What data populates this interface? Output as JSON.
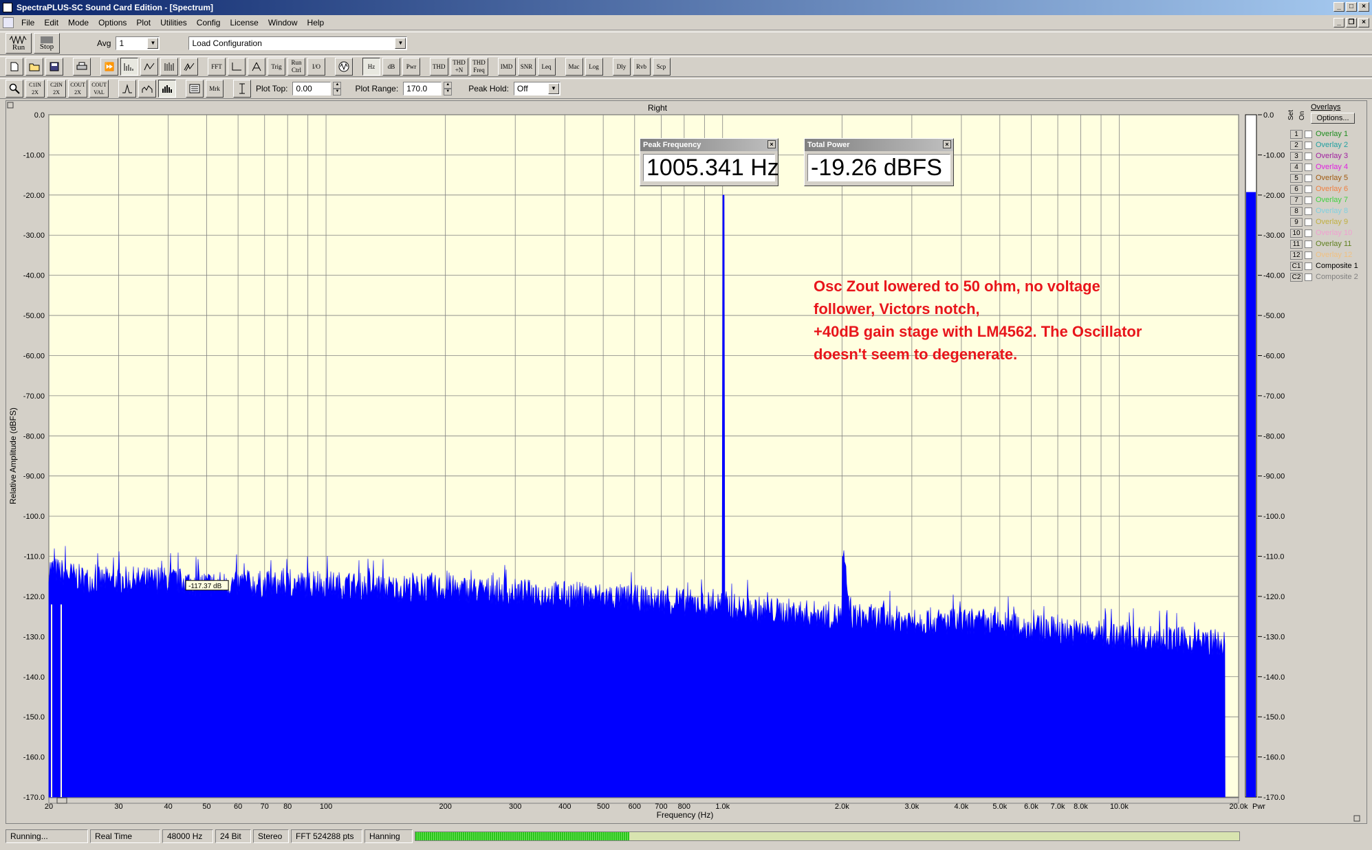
{
  "window": {
    "title": "SpectraPLUS-SC Sound Card Edition - [Spectrum]"
  },
  "menu": [
    "File",
    "Edit",
    "Mode",
    "Options",
    "Plot",
    "Utilities",
    "Config",
    "License",
    "Window",
    "Help"
  ],
  "toolbar1": {
    "run": "Run",
    "stop": "Stop",
    "avg_label": "Avg",
    "avg_value": "1",
    "config_value": "Load Configuration"
  },
  "toolbar2": {
    "buttons": [
      "FFT",
      "Trig",
      "Run Ctrl",
      "I/O",
      "Hz",
      "dB",
      "Pwr",
      "THD",
      "THD +N",
      "THD Freq",
      "IMD",
      "SNR",
      "Leq",
      "Mac",
      "Log",
      "Dly",
      "Rvb",
      "Scp"
    ]
  },
  "toolbar3": {
    "c1n": "C1IN 2X",
    "c2n": "C2IN 2X",
    "cout": "COUT 2X",
    "coutval": "COUT VAL",
    "mrk": "Mrk",
    "plot_top_label": "Plot Top:",
    "plot_top_value": "0.00",
    "plot_range_label": "Plot Range:",
    "plot_range_value": "170.0",
    "peak_hold_label": "Peak Hold:",
    "peak_hold_value": "Off"
  },
  "plot": {
    "channel_label": "Right",
    "marker_label": "-117.37 dB",
    "pwr_label": "Pwr",
    "annotation": [
      "Osc Zout lowered to 50 ohm, no voltage",
      "follower, Victors notch,",
      "+40dB gain stage with LM4562. The Oscillator",
      "doesn't seem to degenerate."
    ]
  },
  "peak_frequency": {
    "title": "Peak Frequency",
    "value": "1005.341 Hz"
  },
  "total_power": {
    "title": "Total Power",
    "value": "-19.26 dBFS"
  },
  "overlays": {
    "title": "Overlays",
    "options": "Options...",
    "set": "Set",
    "on": "On",
    "items": [
      {
        "num": "1",
        "label": "Overlay 1",
        "color": "#1e8c1e"
      },
      {
        "num": "2",
        "label": "Overlay 2",
        "color": "#20a0a0"
      },
      {
        "num": "3",
        "label": "Overlay 3",
        "color": "#a020a0"
      },
      {
        "num": "4",
        "label": "Overlay 4",
        "color": "#e020e0"
      },
      {
        "num": "5",
        "label": "Overlay 5",
        "color": "#a05a10"
      },
      {
        "num": "6",
        "label": "Overlay 6",
        "color": "#f08040"
      },
      {
        "num": "7",
        "label": "Overlay 7",
        "color": "#40d040"
      },
      {
        "num": "8",
        "label": "Overlay 8",
        "color": "#80d0e0"
      },
      {
        "num": "9",
        "label": "Overlay 9",
        "color": "#c0b040"
      },
      {
        "num": "10",
        "label": "Overlay 10",
        "color": "#f0a0d0"
      },
      {
        "num": "11",
        "label": "Overlay 11",
        "color": "#608020"
      },
      {
        "num": "12",
        "label": "Overlay 12",
        "color": "#f0c080"
      },
      {
        "num": "C1",
        "label": "Composite 1",
        "color": "#000000"
      },
      {
        "num": "C2",
        "label": "Composite 2",
        "color": "#808080"
      }
    ]
  },
  "status": {
    "state": "Running...",
    "mode": "Real Time",
    "rate": "48000 Hz",
    "bits": "24 Bit",
    "channels": "Stereo",
    "fft": "FFT 524288 pts",
    "window": "Hanning",
    "meter_level": 0.26
  },
  "colors": {
    "plot_bg": "#ffffe0",
    "spectrum": "#0000ff",
    "grid": "#808080",
    "annotation": "#e8151b"
  },
  "chart_data": {
    "type": "area",
    "xlabel": "Frequency (Hz)",
    "ylabel": "Relative Amplitude (dBFS)",
    "x_scale": "log",
    "xlim": [
      20,
      20000
    ],
    "ylim": [
      -170,
      0
    ],
    "x_ticks": [
      20,
      30,
      40,
      50,
      60,
      70,
      80,
      100,
      200,
      300,
      400,
      500,
      600,
      700,
      800,
      1000,
      2000,
      3000,
      4000,
      5000,
      6000,
      7000,
      8000,
      10000,
      20000
    ],
    "x_tick_labels": [
      "20",
      "30",
      "40",
      "50",
      "60",
      "70",
      "80",
      "100",
      "200",
      "300",
      "400",
      "500",
      "600",
      "700",
      "800",
      "1.0k",
      "2.0k",
      "3.0k",
      "4.0k",
      "5.0k",
      "6.0k",
      "7.0k",
      "8.0k",
      "10.0k",
      "20.0k"
    ],
    "y_ticks": [
      0,
      -10,
      -20,
      -30,
      -40,
      -50,
      -60,
      -70,
      -80,
      -90,
      -100,
      -110,
      -120,
      -130,
      -140,
      -150,
      -160,
      -170
    ],
    "y_tick_labels": [
      "0.0",
      "-10.00",
      "-20.00",
      "-30.00",
      "-40.00",
      "-50.00",
      "-60.00",
      "-70.00",
      "-80.00",
      "-90.00",
      "-100.0",
      "-110.0",
      "-120.0",
      "-130.0",
      "-140.0",
      "-150.0",
      "-160.0",
      "-170.0"
    ],
    "series": [
      {
        "x": [
          20,
          25,
          30,
          40,
          50,
          70,
          100,
          150,
          200,
          300,
          500,
          700,
          900,
          1000,
          1005,
          1010,
          1100,
          1500,
          2000,
          2010,
          2100,
          3000,
          5000,
          8000,
          10000,
          15000,
          20000
        ],
        "y": [
          -114,
          -117,
          -117,
          -117,
          -118,
          -118,
          -118,
          -119,
          -119,
          -120,
          -121,
          -122,
          -123,
          -123,
          -20,
          -123,
          -124,
          -125,
          -126,
          -110,
          -126,
          -127,
          -128,
          -130,
          -131,
          -132,
          -133
        ]
      }
    ],
    "bar_meter": {
      "value": -19.26,
      "ylim": [
        -170,
        0
      ]
    }
  }
}
